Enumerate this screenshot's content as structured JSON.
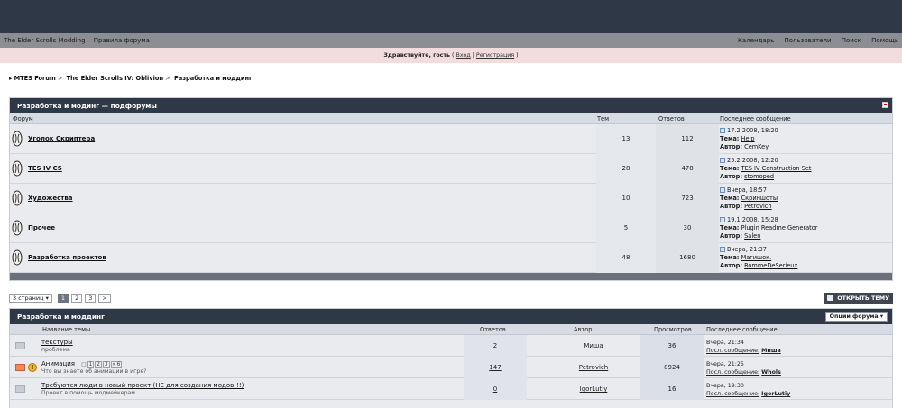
{
  "nav": {
    "left": [
      "The Elder Scrolls Modding",
      "Правила форума"
    ],
    "right": [
      "Календарь",
      "Пользователи",
      "Поиск",
      "Помощь"
    ]
  },
  "welcome": {
    "greeting": "Здравствуйте, гость",
    "login": "Вход",
    "register": "Регистрация"
  },
  "breadcrumb": [
    "MTES Forum",
    "The Elder Scrolls IV: Oblivion",
    "Разработка и моддинг"
  ],
  "subforums": {
    "header": "Разработка и модинг — подфорумы",
    "columns": [
      "Форум",
      "Тем",
      "Ответов",
      "Последнее сообщение"
    ],
    "rows": [
      {
        "name": "Уголок Скриптера",
        "topics": "13",
        "replies": "112",
        "date": "17.2.2008, 18:20",
        "topic": "Help",
        "author": "CemKey"
      },
      {
        "name": "TES IV CS",
        "topics": "28",
        "replies": "478",
        "date": "25.2.2008, 12:20",
        "topic": "TES IV Construction Set",
        "author": "stomoped"
      },
      {
        "name": "Художества",
        "topics": "10",
        "replies": "723",
        "date": "Вчера, 18:57",
        "topic": "Скриншоты",
        "author": "Petrovich"
      },
      {
        "name": "Прочее",
        "topics": "5",
        "replies": "30",
        "date": "19.1.2008, 15:28",
        "topic": "Plugin Readme Generator",
        "author": "Salen"
      },
      {
        "name": "Разработка проектов",
        "topics": "48",
        "replies": "1680",
        "date": "Вчера, 21:37",
        "topic": "Магишок.",
        "author": "RommeDeSerieux"
      }
    ],
    "labels": {
      "topic": "Тема:",
      "author": "Автор:"
    }
  },
  "pagination": {
    "label": "3 страниц",
    "pages": [
      "1",
      "2",
      "3"
    ],
    "next": ">",
    "new_topic": "ОТКРЫТЬ ТЕМУ"
  },
  "topics": {
    "header": "Разработка и моддинг",
    "options": "Опции форума",
    "columns": [
      "Название темы",
      "Ответов",
      "Автор",
      "Просмотров",
      "Последнее сообщение"
    ],
    "rows": [
      {
        "title": "текстуры",
        "desc": "проблема",
        "replies": "2",
        "author": "Миша",
        "views": "36",
        "date": "Вчера, 21:34",
        "last_label": "Посл. сообщение:",
        "last_author": "Миша"
      },
      {
        "title": "Анимация",
        "desc": "Что вы знаете об анимации в игре?",
        "pages": [
          "1",
          "2",
          "3",
          "» 6"
        ],
        "replies": "147",
        "author": "Petrovich",
        "views": "8924",
        "date": "Вчера, 21:25",
        "last_label": "Посл. сообщение:",
        "last_author": "Whols"
      },
      {
        "title": "Требуются люди в новый проект (НЕ для создания модов!!!)",
        "desc": "Проект в помощь модмейкерам",
        "replies": "0",
        "author": "IgorLutiy",
        "views": "16",
        "date": "Вчера, 19:30",
        "last_label": "Посл. сообщение:",
        "last_author": "IgorLutiy"
      }
    ]
  }
}
